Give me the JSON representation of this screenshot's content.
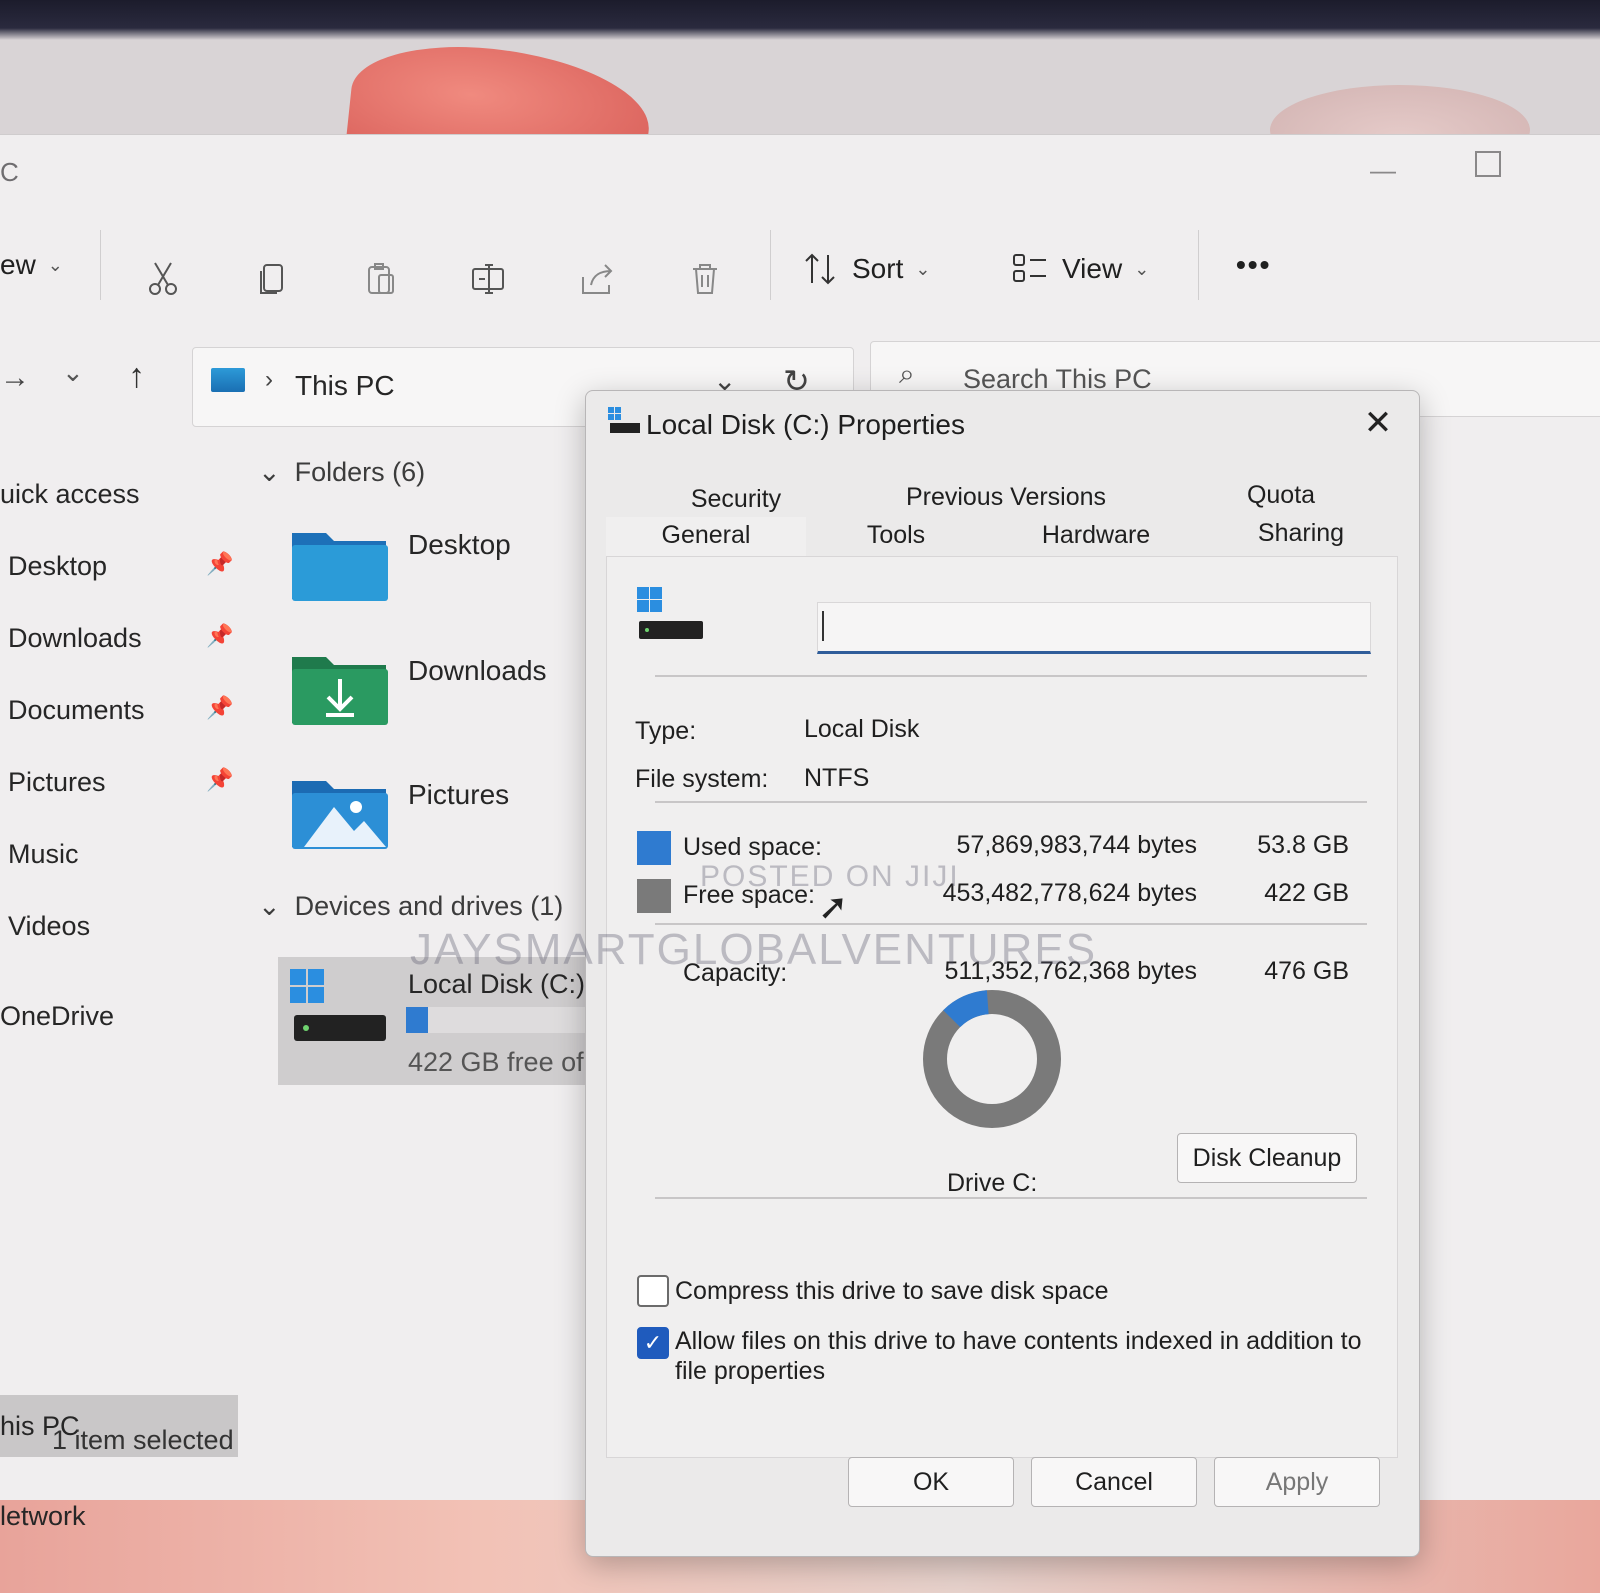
{
  "explorer": {
    "title_fragment": "C",
    "toolbar": {
      "new_label": "ew",
      "sort_label": "Sort",
      "view_label": "View",
      "more_label": "•••"
    },
    "address": {
      "location": "This PC"
    },
    "search": {
      "placeholder": "Search This PC"
    },
    "sidebar": [
      {
        "label": "uick access",
        "pinned": false
      },
      {
        "label": "Desktop",
        "pinned": true
      },
      {
        "label": "Downloads",
        "pinned": true
      },
      {
        "label": "Documents",
        "pinned": true
      },
      {
        "label": "Pictures",
        "pinned": true
      },
      {
        "label": "Music",
        "pinned": false
      },
      {
        "label": "Videos",
        "pinned": false
      },
      {
        "label": "OneDrive",
        "pinned": false
      },
      {
        "label": "his PC",
        "pinned": false,
        "selected": true
      },
      {
        "label": "letwork",
        "pinned": false
      }
    ],
    "folders_header": "Folders (6)",
    "folders": [
      {
        "label": "Desktop",
        "icon": "desktop-folder-icon"
      },
      {
        "label": "Downloads",
        "icon": "downloads-folder-icon"
      },
      {
        "label": "Pictures",
        "icon": "pictures-folder-icon"
      }
    ],
    "drives_header": "Devices and drives (1)",
    "drive": {
      "label": "Local Disk (C:)",
      "free_text": "422 GB free of",
      "used_fraction": 0.11
    },
    "status": "1 item selected"
  },
  "dialog": {
    "title": "Local Disk (C:) Properties",
    "tabs_row1": [
      "Security",
      "Previous Versions",
      "Quota"
    ],
    "tabs_row2": [
      "General",
      "Tools",
      "Hardware",
      "Sharing"
    ],
    "active_tab": "General",
    "name_value": "",
    "type_label": "Type:",
    "type_value": "Local Disk",
    "fs_label": "File system:",
    "fs_value": "NTFS",
    "used_label": "Used space:",
    "used_bytes": "57,869,983,744 bytes",
    "used_size": "53.8 GB",
    "free_label": "Free space:",
    "free_bytes": "453,482,778,624 bytes",
    "free_size": "422 GB",
    "capacity_label": "Capacity:",
    "capacity_bytes": "511,352,762,368 bytes",
    "capacity_size": "476 GB",
    "used_fraction": 0.113,
    "drive_label": "Drive C:",
    "disk_cleanup": "Disk Cleanup",
    "compress_label": "Compress this drive to save disk space",
    "compress_checked": false,
    "index_label_1": "Allow files on this drive to have contents indexed in addition to",
    "index_label_2": "file properties",
    "index_checked": true,
    "ok": "OK",
    "cancel": "Cancel",
    "apply": "Apply",
    "colors": {
      "used": "#2f7bd0",
      "free": "#7a7a7a"
    }
  },
  "watermark": {
    "line1": "POSTED ON JIJI",
    "line2": "JAYSMARTGLOBALVENTURES"
  }
}
